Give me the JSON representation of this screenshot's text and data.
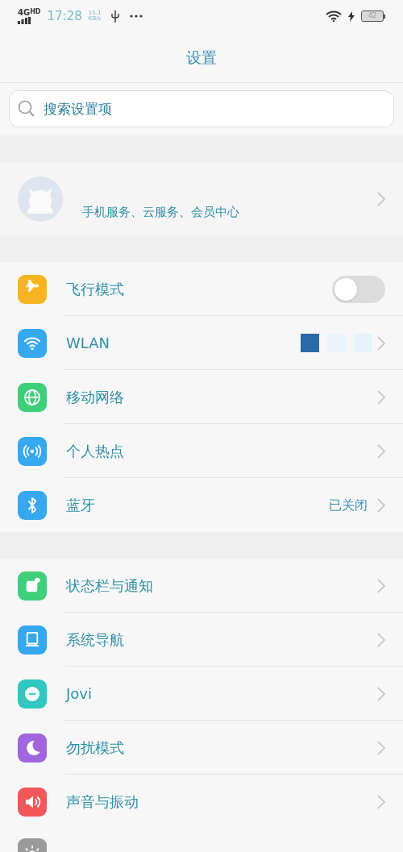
{
  "status_bar": {
    "network": "4G",
    "network_badge": "HD",
    "time": "17:28",
    "speed": "15.1",
    "speed_unit": "KB/s",
    "battery": "42"
  },
  "title": "设置",
  "search": {
    "placeholder": "搜索设置项"
  },
  "account": {
    "subtitle": "手机服务、云服务、会员中心"
  },
  "sections": [
    {
      "items": [
        {
          "kind": "toggle",
          "color": "#f8b420",
          "label": "飞行模式",
          "on": false
        },
        {
          "kind": "redacted",
          "color": "#35a8f0",
          "label": "WLAN"
        },
        {
          "kind": "link",
          "color": "#3fcf7a",
          "label": "移动网络"
        },
        {
          "kind": "link",
          "color": "#35a8f0",
          "label": "个人热点"
        },
        {
          "kind": "link",
          "color": "#35a8f0",
          "label": "蓝牙",
          "value": "已关闭"
        }
      ]
    },
    {
      "items": [
        {
          "kind": "link",
          "color": "#3fcf7a",
          "label": "状态栏与通知"
        },
        {
          "kind": "link",
          "color": "#35a8f0",
          "label": "系统导航"
        },
        {
          "kind": "link",
          "color": "#2fc7c0",
          "label": "Jovi"
        },
        {
          "kind": "link",
          "color": "#a265e0",
          "label": "勿扰模式"
        },
        {
          "kind": "link",
          "color": "#f2555a",
          "label": "声音与振动"
        },
        {
          "kind": "partial",
          "color": "#9a9a9a"
        }
      ]
    }
  ]
}
